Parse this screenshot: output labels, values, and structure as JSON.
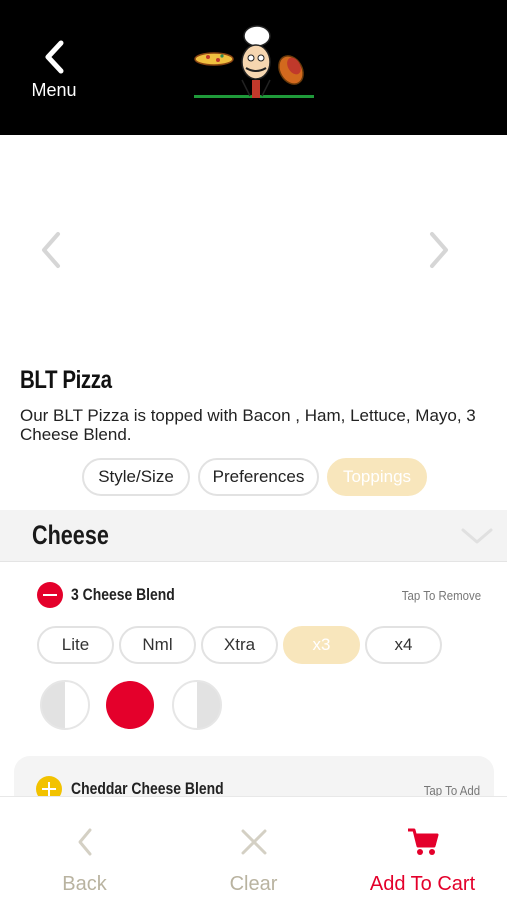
{
  "header": {
    "back_label": "Menu",
    "back_icon": "chevron-left-icon",
    "logo_icon": "chef-logo"
  },
  "carousel": {
    "prev_icon": "chevron-left-icon",
    "next_icon": "chevron-right-icon"
  },
  "product": {
    "title": "BLT Pizza",
    "description": "Our BLT Pizza is topped with Bacon , Ham, Lettuce, Mayo, 3 Cheese Blend."
  },
  "tabs": [
    {
      "label": "Style/Size",
      "active": false
    },
    {
      "label": "Preferences",
      "active": false
    },
    {
      "label": "Toppings",
      "active": true
    }
  ],
  "section": {
    "title": "Cheese",
    "chevron_icon": "chevron-down-icon"
  },
  "toppings": [
    {
      "name": "3 Cheese Blend",
      "action": "Tap To Remove",
      "selected": true,
      "amounts": [
        {
          "label": "Lite",
          "active": false
        },
        {
          "label": "Nml",
          "active": false
        },
        {
          "label": "Xtra",
          "active": false
        },
        {
          "label": "x3",
          "active": true
        },
        {
          "label": "x4",
          "active": false
        }
      ],
      "placement": "whole"
    },
    {
      "name": "Cheddar Cheese Blend",
      "action": "Tap To Add",
      "selected": false
    }
  ],
  "bottom_bar": {
    "back_label": "Back",
    "clear_label": "Clear",
    "cart_label": "Add To Cart"
  },
  "colors": {
    "header_bg": "#000000",
    "accent_red": "#e4002b",
    "active_pill": "#f8e6bc",
    "add_yellow": "#f2c200",
    "muted_label": "#b9b3a0"
  }
}
